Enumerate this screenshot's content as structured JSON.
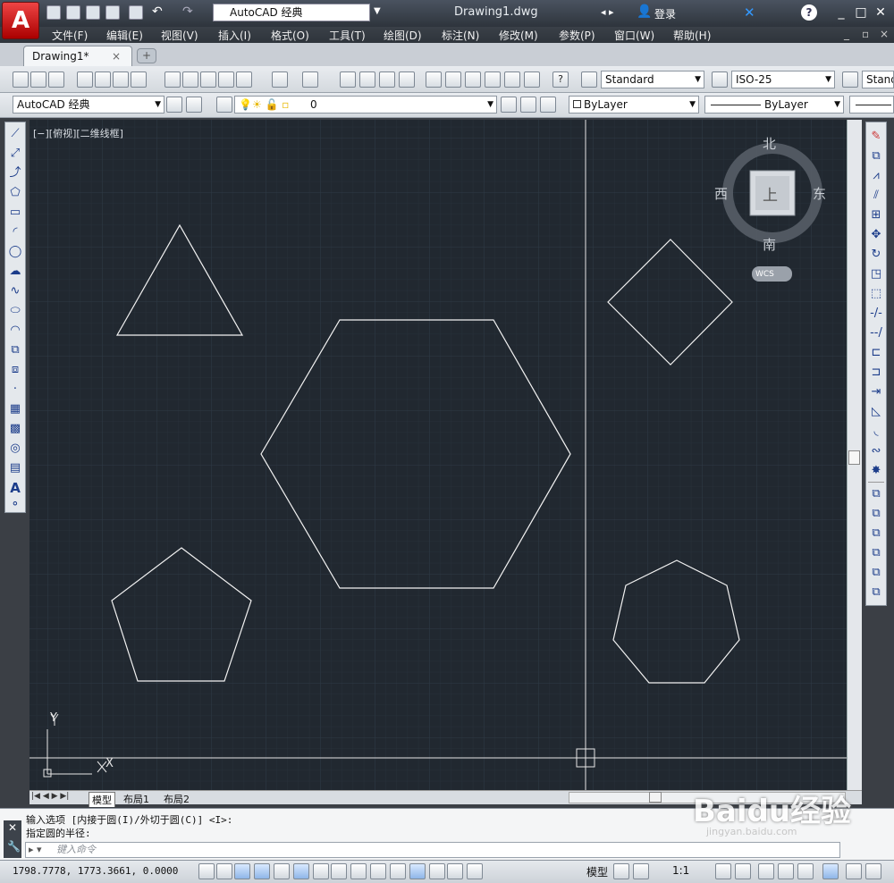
{
  "app": {
    "logo": "A",
    "document_title": "Drawing1.dwg",
    "workspace": "AutoCAD 经典",
    "login_label": "登录"
  },
  "menu": [
    "文件(F)",
    "编辑(E)",
    "视图(V)",
    "插入(I)",
    "格式(O)",
    "工具(T)",
    "绘图(D)",
    "标注(N)",
    "修改(M)",
    "参数(P)",
    "窗口(W)",
    "帮助(H)"
  ],
  "tabs": {
    "document": "Drawing1*",
    "close": "×",
    "new": "+"
  },
  "toolbar1": {
    "text_style": "Standard",
    "dim_style": "ISO-25",
    "table_style": "Standard"
  },
  "toolbar2": {
    "workspace": "AutoCAD 经典",
    "layer": "0",
    "color": "ByLayer",
    "linetype": "ByLayer"
  },
  "viewport": {
    "label": "[−][俯视][二维线框]"
  },
  "viewcube": {
    "north": "北",
    "south": "南",
    "east": "东",
    "west": "西",
    "face": "上",
    "wcs": "WCS"
  },
  "ucs": {
    "x": "X",
    "y": "Y"
  },
  "layout_tabs": [
    "模型",
    "布局1",
    "布局2"
  ],
  "command": {
    "line1": "输入选项 [内接于圆(I)/外切于圆(C)] <I>:",
    "line2": "指定圆的半径:",
    "placeholder": "键入命令"
  },
  "status": {
    "coords": "1798.7778, 1773.3661, 0.0000",
    "model": "模型",
    "scale": "1:1"
  },
  "watermark": {
    "text": "Baidu经验",
    "url": "jingyan.baidu.com"
  },
  "colors": {
    "canvas": "#212830",
    "geometry": "#ffffff",
    "accent": "#c0181f"
  }
}
